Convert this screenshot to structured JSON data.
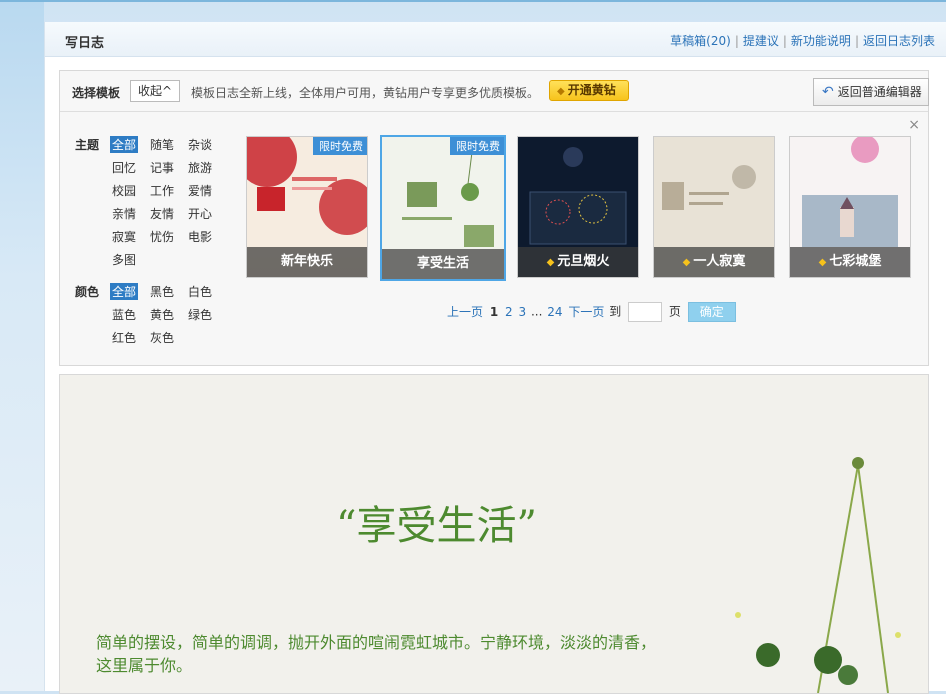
{
  "header": {
    "title": "写日志",
    "links": [
      "草稿箱(20)",
      "提建议",
      "新功能说明",
      "返回日志列表"
    ]
  },
  "template_bar": {
    "label": "选择模板",
    "collapse_label": "收起",
    "notice": "模板日志全新上线，全体用户可用，黄钻用户专享更多优质模板。",
    "vip_label": "开通黄钻",
    "back_label": "返回普通编辑器",
    "close": "×"
  },
  "filters": {
    "theme_label": "主题",
    "themes": [
      "全部",
      "随笔",
      "杂谈",
      "回忆",
      "记事",
      "旅游",
      "校园",
      "工作",
      "爱情",
      "亲情",
      "友情",
      "开心",
      "寂寞",
      "忧伤",
      "电影",
      "多图"
    ],
    "color_label": "颜色",
    "colors": [
      "全部",
      "黑色",
      "白色",
      "蓝色",
      "黄色",
      "绿色",
      "红色",
      "灰色"
    ]
  },
  "templates": [
    {
      "name": "新年快乐",
      "badge": "限时免费",
      "vip": false
    },
    {
      "name": "享受生活",
      "badge": "限时免费",
      "vip": false
    },
    {
      "name": "元旦烟火",
      "badge": "",
      "vip": true
    },
    {
      "name": "一人寂寞",
      "badge": "",
      "vip": true
    },
    {
      "name": "七彩城堡",
      "badge": "",
      "vip": true
    }
  ],
  "pager": {
    "prev": "上一页",
    "current": "1",
    "p2": "2",
    "p3": "3",
    "ellipsis": "...",
    "last": "24",
    "next": "下一页",
    "goto": "到",
    "page": "页",
    "ok": "确定"
  },
  "editor": {
    "title": "“享受生活”",
    "body": "简单的摆设，简单的调调，抛开外面的喧闹霓虹城市。宁静环境，淡淡的清香，这里属于你。"
  },
  "colors": {
    "accent": "#2b73b8",
    "selected": "#2e7cc4",
    "vip": "#f7c31c",
    "title_green": "#4d8a2f"
  }
}
